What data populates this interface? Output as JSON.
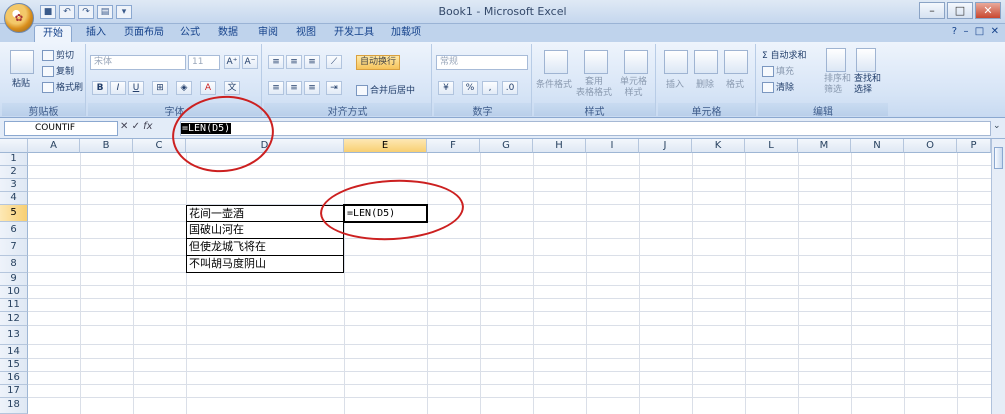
{
  "window": {
    "title": "Book1 - Microsoft Excel",
    "office_button": "Office",
    "qat_icons": [
      "save-icon",
      "undo-icon",
      "redo-icon",
      "print-preview-icon",
      "open-icon"
    ]
  },
  "tabs": [
    "开始",
    "插入",
    "页面布局",
    "公式",
    "数据",
    "审阅",
    "视图",
    "开发工具",
    "加载项"
  ],
  "ribbon": {
    "clipboard": {
      "label": "剪贴板",
      "paste": "粘贴",
      "cut": "剪切",
      "copy": "复制",
      "format_painter": "格式刷"
    },
    "font": {
      "label": "字体",
      "font_name": "宋体",
      "font_size": "11",
      "bold": "B",
      "italic": "I",
      "underline": "U",
      "grow": "A⁺",
      "shrink": "A⁻"
    },
    "alignment": {
      "label": "对齐方式",
      "wrap": "自动换行",
      "merge": "合并后居中"
    },
    "number": {
      "label": "数字",
      "format": "常规",
      "percent": "%"
    },
    "styles": {
      "label": "样式",
      "cond_format": "条件格式",
      "table_format": "套用\n表格格式",
      "cell_styles": "单元格\n样式"
    },
    "cells": {
      "label": "单元格",
      "insert": "插入",
      "delete": "删除",
      "format": "格式"
    },
    "editing": {
      "label": "编辑",
      "autosum": "Σ 自动求和",
      "fill": "填充",
      "clear": "清除",
      "sort": "排序和\n筛选",
      "find": "查找和\n选择"
    }
  },
  "formula_bar": {
    "name_box": "COUNTIF",
    "fx": "fx",
    "formula": "=LEN(D5)"
  },
  "columns": [
    "A",
    "B",
    "C",
    "D",
    "E",
    "F",
    "G",
    "H",
    "I",
    "J",
    "K",
    "L",
    "M",
    "N",
    "O",
    "P"
  ],
  "rows": [
    "1",
    "2",
    "3",
    "4",
    "5",
    "6",
    "7",
    "8",
    "9",
    "10",
    "11",
    "12",
    "13",
    "14",
    "15",
    "16",
    "17",
    "18"
  ],
  "cells": {
    "D5": "花间一壶酒",
    "D6": "国破山河在",
    "D7": "但使龙城飞将在",
    "D8": "不叫胡马度阴山",
    "E5": "=LEN(D5)"
  },
  "colors": {
    "accent": "#15428b",
    "annotation": "#cc2020",
    "selected_header": "#f8cf72"
  }
}
